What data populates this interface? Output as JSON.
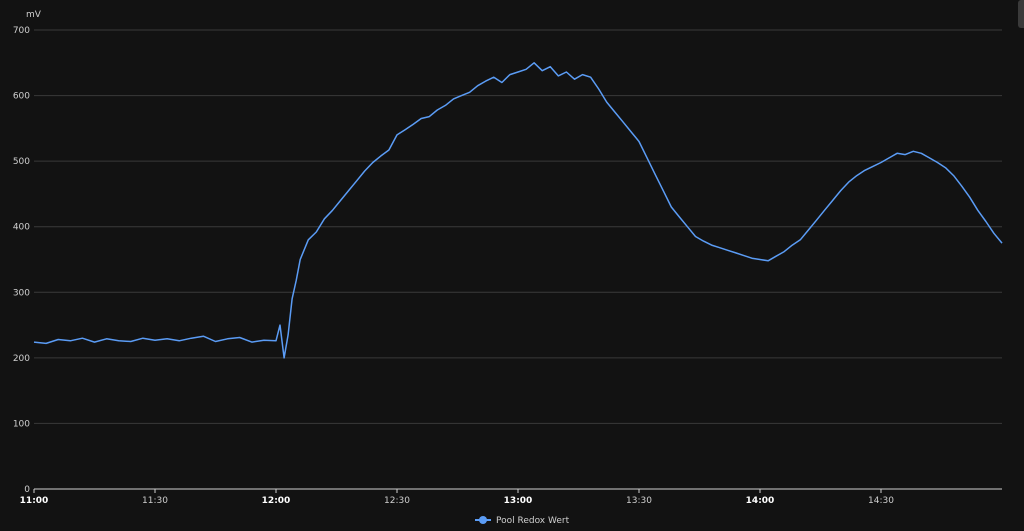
{
  "chart_data": {
    "type": "line",
    "title": "",
    "xlabel": "",
    "ylabel": "mV",
    "ylim": [
      0,
      700
    ],
    "xlim": [
      "11:00",
      "15:00"
    ],
    "y_ticks": [
      "0",
      "100",
      "200",
      "300",
      "400",
      "500",
      "600",
      "700"
    ],
    "x_ticks": [
      {
        "label": "11:00",
        "major": true
      },
      {
        "label": "11:30",
        "major": false
      },
      {
        "label": "12:00",
        "major": true
      },
      {
        "label": "12:30",
        "major": false
      },
      {
        "label": "13:00",
        "major": true
      },
      {
        "label": "13:30",
        "major": false
      },
      {
        "label": "14:00",
        "major": true
      },
      {
        "label": "14:30",
        "major": false
      }
    ],
    "grid": true,
    "legend_position": "bottom-center",
    "series": [
      {
        "name": "Pool Redox Wert",
        "color": "#5b9cf5",
        "points": [
          [
            "11:00",
            224
          ],
          [
            "11:03",
            222
          ],
          [
            "11:06",
            228
          ],
          [
            "11:09",
            226
          ],
          [
            "11:12",
            230
          ],
          [
            "11:15",
            224
          ],
          [
            "11:18",
            229
          ],
          [
            "11:21",
            226
          ],
          [
            "11:24",
            225
          ],
          [
            "11:27",
            230
          ],
          [
            "11:30",
            227
          ],
          [
            "11:33",
            229
          ],
          [
            "11:36",
            226
          ],
          [
            "11:39",
            230
          ],
          [
            "11:42",
            233
          ],
          [
            "11:45",
            225
          ],
          [
            "11:48",
            229
          ],
          [
            "11:51",
            231
          ],
          [
            "11:54",
            224
          ],
          [
            "11:57",
            227
          ],
          [
            "12:00",
            226
          ],
          [
            "12:01",
            250
          ],
          [
            "12:02",
            200
          ],
          [
            "12:03",
            235
          ],
          [
            "12:04",
            290
          ],
          [
            "12:05",
            318
          ],
          [
            "12:06",
            350
          ],
          [
            "12:08",
            380
          ],
          [
            "12:10",
            392
          ],
          [
            "12:12",
            412
          ],
          [
            "12:14",
            425
          ],
          [
            "12:16",
            440
          ],
          [
            "12:18",
            455
          ],
          [
            "12:20",
            470
          ],
          [
            "12:22",
            485
          ],
          [
            "12:24",
            498
          ],
          [
            "12:26",
            508
          ],
          [
            "12:28",
            517
          ],
          [
            "12:30",
            540
          ],
          [
            "12:32",
            548
          ],
          [
            "12:34",
            556
          ],
          [
            "12:36",
            565
          ],
          [
            "12:38",
            568
          ],
          [
            "12:40",
            578
          ],
          [
            "12:42",
            585
          ],
          [
            "12:44",
            595
          ],
          [
            "12:46",
            600
          ],
          [
            "12:48",
            605
          ],
          [
            "12:50",
            615
          ],
          [
            "12:52",
            622
          ],
          [
            "12:54",
            628
          ],
          [
            "12:56",
            620
          ],
          [
            "12:58",
            632
          ],
          [
            "13:00",
            636
          ],
          [
            "13:02",
            640
          ],
          [
            "13:04",
            650
          ],
          [
            "13:06",
            638
          ],
          [
            "13:08",
            644
          ],
          [
            "13:10",
            630
          ],
          [
            "13:12",
            636
          ],
          [
            "13:14",
            625
          ],
          [
            "13:16",
            632
          ],
          [
            "13:18",
            628
          ],
          [
            "13:20",
            610
          ],
          [
            "13:22",
            590
          ],
          [
            "13:24",
            575
          ],
          [
            "13:26",
            560
          ],
          [
            "13:28",
            545
          ],
          [
            "13:30",
            530
          ],
          [
            "13:32",
            505
          ],
          [
            "13:34",
            480
          ],
          [
            "13:36",
            455
          ],
          [
            "13:38",
            430
          ],
          [
            "13:40",
            415
          ],
          [
            "13:42",
            400
          ],
          [
            "13:44",
            385
          ],
          [
            "13:46",
            378
          ],
          [
            "13:48",
            372
          ],
          [
            "13:50",
            368
          ],
          [
            "13:52",
            364
          ],
          [
            "13:54",
            360
          ],
          [
            "13:56",
            356
          ],
          [
            "13:58",
            352
          ],
          [
            "14:00",
            350
          ],
          [
            "14:02",
            348
          ],
          [
            "14:04",
            355
          ],
          [
            "14:06",
            362
          ],
          [
            "14:08",
            372
          ],
          [
            "14:10",
            380
          ],
          [
            "14:12",
            395
          ],
          [
            "14:14",
            410
          ],
          [
            "14:16",
            425
          ],
          [
            "14:18",
            440
          ],
          [
            "14:20",
            455
          ],
          [
            "14:22",
            468
          ],
          [
            "14:24",
            478
          ],
          [
            "14:26",
            486
          ],
          [
            "14:28",
            492
          ],
          [
            "14:30",
            498
          ],
          [
            "14:32",
            505
          ],
          [
            "14:34",
            512
          ],
          [
            "14:36",
            510
          ],
          [
            "14:38",
            515
          ],
          [
            "14:40",
            512
          ],
          [
            "14:42",
            505
          ],
          [
            "14:44",
            498
          ],
          [
            "14:46",
            490
          ],
          [
            "14:48",
            478
          ],
          [
            "14:50",
            462
          ],
          [
            "14:52",
            445
          ],
          [
            "14:54",
            425
          ],
          [
            "14:56",
            408
          ],
          [
            "14:58",
            390
          ],
          [
            "15:00",
            375
          ]
        ]
      }
    ]
  }
}
